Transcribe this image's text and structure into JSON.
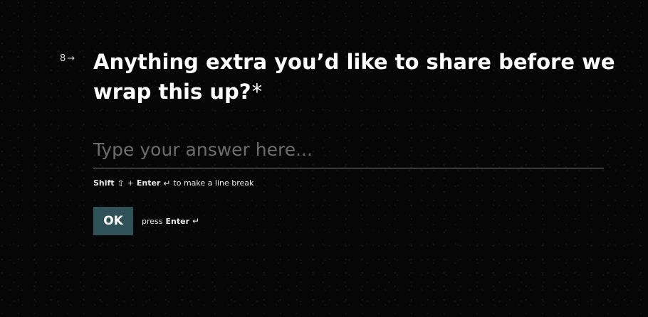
{
  "question": {
    "number": "8",
    "arrow_icon": "arrow-right-icon",
    "title": "Anything extra you’d like to share before we wrap this up?",
    "required_marker": "*"
  },
  "answer": {
    "value": "",
    "placeholder": "Type your answer here..."
  },
  "line_break_hint": {
    "shift_label": "Shift",
    "shift_icon": "⇧",
    "plus_label": "+",
    "enter_label": "Enter",
    "enter_icon": "↵",
    "rest_label": "to make a line break"
  },
  "submit": {
    "button_label": "OK",
    "press_label": "press",
    "enter_label": "Enter",
    "enter_icon": "↵"
  },
  "colors": {
    "background": "#060606",
    "button": "#2e5258",
    "text": "#ffffff",
    "placeholder": "#6c6c6c"
  }
}
